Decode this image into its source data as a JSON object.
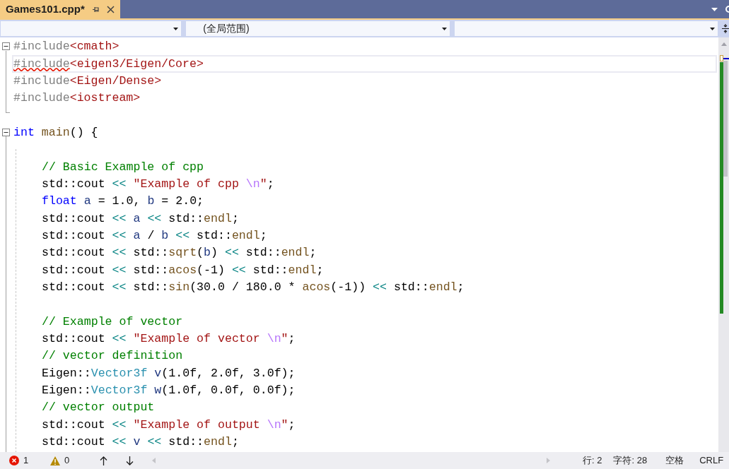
{
  "tabs": [
    {
      "label": "Games101.cpp*",
      "selected": true
    }
  ],
  "nav_bar": {
    "scope_combo": "(全局范围)"
  },
  "code_lines": [
    {
      "kind": "code",
      "fold": true,
      "current": false,
      "segments": [
        {
          "kind": "pp",
          "text": "#include"
        },
        {
          "kind": "hdr",
          "text": "<cmath>"
        }
      ]
    },
    {
      "kind": "code",
      "fold": false,
      "current": true,
      "segments": [
        {
          "kind": "pperr",
          "text": "#include"
        },
        {
          "kind": "hdr",
          "text": "<eigen3/Eigen/Core>"
        }
      ]
    },
    {
      "kind": "code",
      "fold": false,
      "current": false,
      "segments": [
        {
          "kind": "pp",
          "text": "#include"
        },
        {
          "kind": "hdr",
          "text": "<Eigen/Dense>"
        }
      ]
    },
    {
      "kind": "code",
      "fold": false,
      "current": false,
      "segments": [
        {
          "kind": "pp",
          "text": "#include"
        },
        {
          "kind": "hdr",
          "text": "<iostream>"
        }
      ]
    },
    {
      "kind": "blank"
    },
    {
      "kind": "code",
      "fold": true,
      "current": false,
      "segments": [
        {
          "kind": "kw",
          "text": "int "
        },
        {
          "kind": "fn",
          "text": "main"
        },
        {
          "kind": "p",
          "text": "() {"
        }
      ],
      "children": [
        {
          "kind": "blank"
        },
        {
          "kind": "code",
          "fold": false,
          "current": false,
          "segments": [
            {
              "kind": "cm",
              "text": "// Basic Example of cpp"
            }
          ]
        },
        {
          "kind": "code",
          "fold": false,
          "current": false,
          "segments": [
            {
              "kind": "p",
              "text": "std::cout "
            },
            {
              "kind": "op",
              "text": "<< "
            },
            {
              "kind": "str",
              "text": "\"Example of cpp "
            },
            {
              "kind": "esc",
              "text": "\\n"
            },
            {
              "kind": "str",
              "text": "\""
            },
            {
              "kind": "p",
              "text": ";"
            }
          ]
        },
        {
          "kind": "code",
          "fold": false,
          "current": false,
          "segments": [
            {
              "kind": "kw",
              "text": "float "
            },
            {
              "kind": "var",
              "text": "a"
            },
            {
              "kind": "p",
              "text": " = 1.0, "
            },
            {
              "kind": "var",
              "text": "b"
            },
            {
              "kind": "p",
              "text": " = 2.0;"
            }
          ]
        },
        {
          "kind": "code",
          "fold": false,
          "current": false,
          "segments": [
            {
              "kind": "p",
              "text": "std::cout "
            },
            {
              "kind": "op",
              "text": "<< "
            },
            {
              "kind": "var",
              "text": "a "
            },
            {
              "kind": "op",
              "text": "<<"
            },
            {
              "kind": "p",
              "text": " std::"
            },
            {
              "kind": "fn",
              "text": "endl"
            },
            {
              "kind": "p",
              "text": ";"
            }
          ]
        },
        {
          "kind": "code",
          "fold": false,
          "current": false,
          "segments": [
            {
              "kind": "p",
              "text": "std::cout "
            },
            {
              "kind": "op",
              "text": "<< "
            },
            {
              "kind": "var",
              "text": "a"
            },
            {
              "kind": "p",
              "text": " / "
            },
            {
              "kind": "var",
              "text": "b "
            },
            {
              "kind": "op",
              "text": "<<"
            },
            {
              "kind": "p",
              "text": " std::"
            },
            {
              "kind": "fn",
              "text": "endl"
            },
            {
              "kind": "p",
              "text": ";"
            }
          ]
        },
        {
          "kind": "code",
          "fold": false,
          "current": false,
          "segments": [
            {
              "kind": "p",
              "text": "std::cout "
            },
            {
              "kind": "op",
              "text": "<<"
            },
            {
              "kind": "p",
              "text": " std::"
            },
            {
              "kind": "fn",
              "text": "sqrt"
            },
            {
              "kind": "p",
              "text": "("
            },
            {
              "kind": "var",
              "text": "b"
            },
            {
              "kind": "p",
              "text": ") "
            },
            {
              "kind": "op",
              "text": "<<"
            },
            {
              "kind": "p",
              "text": " std::"
            },
            {
              "kind": "fn",
              "text": "endl"
            },
            {
              "kind": "p",
              "text": ";"
            }
          ]
        },
        {
          "kind": "code",
          "fold": false,
          "current": false,
          "segments": [
            {
              "kind": "p",
              "text": "std::cout "
            },
            {
              "kind": "op",
              "text": "<<"
            },
            {
              "kind": "p",
              "text": " std::"
            },
            {
              "kind": "fn",
              "text": "acos"
            },
            {
              "kind": "p",
              "text": "(-1) "
            },
            {
              "kind": "op",
              "text": "<<"
            },
            {
              "kind": "p",
              "text": " std::"
            },
            {
              "kind": "fn",
              "text": "endl"
            },
            {
              "kind": "p",
              "text": ";"
            }
          ]
        },
        {
          "kind": "code",
          "fold": false,
          "current": false,
          "segments": [
            {
              "kind": "p",
              "text": "std::cout "
            },
            {
              "kind": "op",
              "text": "<<"
            },
            {
              "kind": "p",
              "text": " std::"
            },
            {
              "kind": "fn",
              "text": "sin"
            },
            {
              "kind": "p",
              "text": "(30.0 / 180.0 * "
            },
            {
              "kind": "fn",
              "text": "acos"
            },
            {
              "kind": "p",
              "text": "(-1)) "
            },
            {
              "kind": "op",
              "text": "<<"
            },
            {
              "kind": "p",
              "text": " std::"
            },
            {
              "kind": "fn",
              "text": "endl"
            },
            {
              "kind": "p",
              "text": ";"
            }
          ]
        },
        {
          "kind": "blank"
        },
        {
          "kind": "code",
          "fold": false,
          "current": false,
          "segments": [
            {
              "kind": "cm",
              "text": "// Example of vector"
            }
          ]
        },
        {
          "kind": "code",
          "fold": false,
          "current": false,
          "segments": [
            {
              "kind": "p",
              "text": "std::cout "
            },
            {
              "kind": "op",
              "text": "<< "
            },
            {
              "kind": "str",
              "text": "\"Example of vector "
            },
            {
              "kind": "esc",
              "text": "\\n"
            },
            {
              "kind": "str",
              "text": "\""
            },
            {
              "kind": "p",
              "text": ";"
            }
          ]
        },
        {
          "kind": "code",
          "fold": false,
          "current": false,
          "segments": [
            {
              "kind": "cm",
              "text": "// vector definition"
            }
          ]
        },
        {
          "kind": "code",
          "fold": false,
          "current": false,
          "segments": [
            {
              "kind": "p",
              "text": "Eigen::"
            },
            {
              "kind": "ty",
              "text": "Vector3f "
            },
            {
              "kind": "var",
              "text": "v"
            },
            {
              "kind": "p",
              "text": "(1.0f, 2.0f, 3.0f);"
            }
          ]
        },
        {
          "kind": "code",
          "fold": false,
          "current": false,
          "segments": [
            {
              "kind": "p",
              "text": "Eigen::"
            },
            {
              "kind": "ty",
              "text": "Vector3f "
            },
            {
              "kind": "var",
              "text": "w"
            },
            {
              "kind": "p",
              "text": "(1.0f, 0.0f, 0.0f);"
            }
          ]
        },
        {
          "kind": "code",
          "fold": false,
          "current": false,
          "segments": [
            {
              "kind": "cm",
              "text": "// vector output"
            }
          ]
        },
        {
          "kind": "code",
          "fold": false,
          "current": false,
          "segments": [
            {
              "kind": "p",
              "text": "std::cout "
            },
            {
              "kind": "op",
              "text": "<< "
            },
            {
              "kind": "str",
              "text": "\"Example of output "
            },
            {
              "kind": "esc",
              "text": "\\n"
            },
            {
              "kind": "str",
              "text": "\""
            },
            {
              "kind": "p",
              "text": ";"
            }
          ]
        },
        {
          "kind": "code",
          "fold": false,
          "current": false,
          "segments": [
            {
              "kind": "p",
              "text": "std::cout "
            },
            {
              "kind": "op",
              "text": "<< "
            },
            {
              "kind": "var",
              "text": "v "
            },
            {
              "kind": "op",
              "text": "<<"
            },
            {
              "kind": "p",
              "text": " std::"
            },
            {
              "kind": "fn",
              "text": "endl"
            },
            {
              "kind": "p",
              "text": ";"
            }
          ]
        }
      ]
    }
  ],
  "status_bar": {
    "errors": "1",
    "warnings": "0",
    "line": "行: 2",
    "column": "字符: 28",
    "indent": "空格",
    "line_ending": "CRLF"
  }
}
